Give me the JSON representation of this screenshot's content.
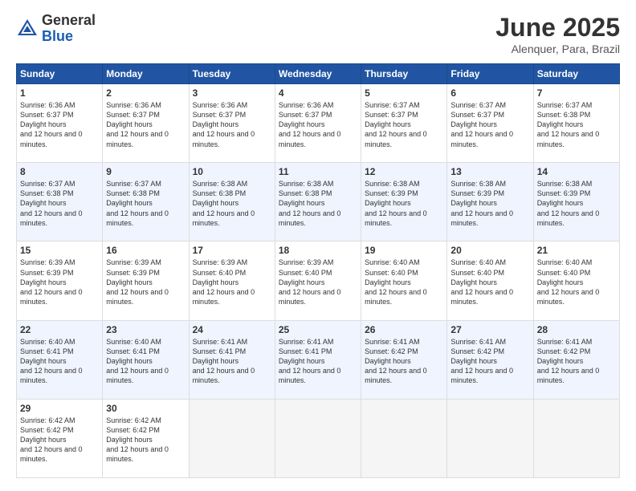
{
  "header": {
    "logo_general": "General",
    "logo_blue": "Blue",
    "title": "June 2025",
    "location": "Alenquer, Para, Brazil"
  },
  "columns": [
    "Sunday",
    "Monday",
    "Tuesday",
    "Wednesday",
    "Thursday",
    "Friday",
    "Saturday"
  ],
  "weeks": [
    [
      {
        "day": "1",
        "sunrise": "6:36 AM",
        "sunset": "6:37 PM",
        "daylight": "12 hours and 0 minutes."
      },
      {
        "day": "2",
        "sunrise": "6:36 AM",
        "sunset": "6:37 PM",
        "daylight": "12 hours and 0 minutes."
      },
      {
        "day": "3",
        "sunrise": "6:36 AM",
        "sunset": "6:37 PM",
        "daylight": "12 hours and 0 minutes."
      },
      {
        "day": "4",
        "sunrise": "6:36 AM",
        "sunset": "6:37 PM",
        "daylight": "12 hours and 0 minutes."
      },
      {
        "day": "5",
        "sunrise": "6:37 AM",
        "sunset": "6:37 PM",
        "daylight": "12 hours and 0 minutes."
      },
      {
        "day": "6",
        "sunrise": "6:37 AM",
        "sunset": "6:37 PM",
        "daylight": "12 hours and 0 minutes."
      },
      {
        "day": "7",
        "sunrise": "6:37 AM",
        "sunset": "6:38 PM",
        "daylight": "12 hours and 0 minutes."
      }
    ],
    [
      {
        "day": "8",
        "sunrise": "6:37 AM",
        "sunset": "6:38 PM",
        "daylight": "12 hours and 0 minutes."
      },
      {
        "day": "9",
        "sunrise": "6:37 AM",
        "sunset": "6:38 PM",
        "daylight": "12 hours and 0 minutes."
      },
      {
        "day": "10",
        "sunrise": "6:38 AM",
        "sunset": "6:38 PM",
        "daylight": "12 hours and 0 minutes."
      },
      {
        "day": "11",
        "sunrise": "6:38 AM",
        "sunset": "6:38 PM",
        "daylight": "12 hours and 0 minutes."
      },
      {
        "day": "12",
        "sunrise": "6:38 AM",
        "sunset": "6:39 PM",
        "daylight": "12 hours and 0 minutes."
      },
      {
        "day": "13",
        "sunrise": "6:38 AM",
        "sunset": "6:39 PM",
        "daylight": "12 hours and 0 minutes."
      },
      {
        "day": "14",
        "sunrise": "6:38 AM",
        "sunset": "6:39 PM",
        "daylight": "12 hours and 0 minutes."
      }
    ],
    [
      {
        "day": "15",
        "sunrise": "6:39 AM",
        "sunset": "6:39 PM",
        "daylight": "12 hours and 0 minutes."
      },
      {
        "day": "16",
        "sunrise": "6:39 AM",
        "sunset": "6:39 PM",
        "daylight": "12 hours and 0 minutes."
      },
      {
        "day": "17",
        "sunrise": "6:39 AM",
        "sunset": "6:40 PM",
        "daylight": "12 hours and 0 minutes."
      },
      {
        "day": "18",
        "sunrise": "6:39 AM",
        "sunset": "6:40 PM",
        "daylight": "12 hours and 0 minutes."
      },
      {
        "day": "19",
        "sunrise": "6:40 AM",
        "sunset": "6:40 PM",
        "daylight": "12 hours and 0 minutes."
      },
      {
        "day": "20",
        "sunrise": "6:40 AM",
        "sunset": "6:40 PM",
        "daylight": "12 hours and 0 minutes."
      },
      {
        "day": "21",
        "sunrise": "6:40 AM",
        "sunset": "6:40 PM",
        "daylight": "12 hours and 0 minutes."
      }
    ],
    [
      {
        "day": "22",
        "sunrise": "6:40 AM",
        "sunset": "6:41 PM",
        "daylight": "12 hours and 0 minutes."
      },
      {
        "day": "23",
        "sunrise": "6:40 AM",
        "sunset": "6:41 PM",
        "daylight": "12 hours and 0 minutes."
      },
      {
        "day": "24",
        "sunrise": "6:41 AM",
        "sunset": "6:41 PM",
        "daylight": "12 hours and 0 minutes."
      },
      {
        "day": "25",
        "sunrise": "6:41 AM",
        "sunset": "6:41 PM",
        "daylight": "12 hours and 0 minutes."
      },
      {
        "day": "26",
        "sunrise": "6:41 AM",
        "sunset": "6:42 PM",
        "daylight": "12 hours and 0 minutes."
      },
      {
        "day": "27",
        "sunrise": "6:41 AM",
        "sunset": "6:42 PM",
        "daylight": "12 hours and 0 minutes."
      },
      {
        "day": "28",
        "sunrise": "6:41 AM",
        "sunset": "6:42 PM",
        "daylight": "12 hours and 0 minutes."
      }
    ],
    [
      {
        "day": "29",
        "sunrise": "6:42 AM",
        "sunset": "6:42 PM",
        "daylight": "12 hours and 0 minutes."
      },
      {
        "day": "30",
        "sunrise": "6:42 AM",
        "sunset": "6:42 PM",
        "daylight": "12 hours and 0 minutes."
      },
      null,
      null,
      null,
      null,
      null
    ]
  ]
}
